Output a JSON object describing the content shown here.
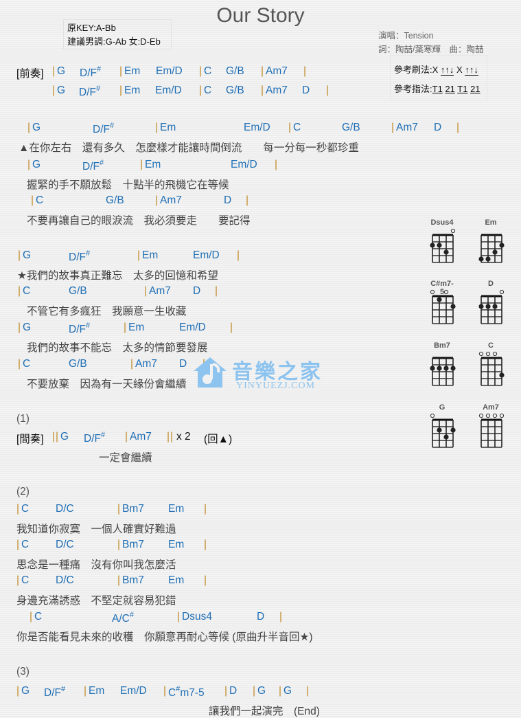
{
  "title": "Our Story",
  "key_info": {
    "original_key": "原KEY:A-Bb",
    "suggested_key": "建議男調:G-Ab 女:D-Eb"
  },
  "credits": {
    "singer": "演唱：Tension",
    "writers": "詞：陶喆/葉寒輝　曲：陶喆"
  },
  "reference": {
    "strum_label": "參考刷法:",
    "strum_pattern": [
      "X",
      "↑↑↓",
      "X",
      "↑↑↓"
    ],
    "finger_label": "參考指法:",
    "finger_pattern": [
      "T1",
      "21",
      "T1",
      "21"
    ]
  },
  "intro": {
    "label": "[前奏]",
    "lines": [
      [
        "G",
        "D/F#",
        "Em",
        "Em/D",
        "C",
        "G/B",
        "Am7"
      ],
      [
        "G",
        "D/F#",
        "Em",
        "Em/D",
        "C",
        "G/B",
        "Am7",
        "D"
      ]
    ]
  },
  "verse": [
    {
      "chords": [
        "G",
        "D/F#",
        "Em",
        "Em/D",
        "C",
        "G/B",
        "Am7",
        "D"
      ],
      "lyric": "▲在你左右　還有多久　怎麼樣才能讓時間倒流　　每一分每一秒都珍重"
    },
    {
      "chords": [
        "G",
        "D/F#",
        "Em",
        "Em/D"
      ],
      "lyric": "握緊的手不願放鬆　十點半的飛機它在等候"
    },
    {
      "chords": [
        "C",
        "G/B",
        "Am7",
        "D"
      ],
      "lyric": "不要再讓自己的眼淚流　我必須要走　　要記得"
    }
  ],
  "chorus": [
    {
      "chords": [
        "G",
        "D/F#",
        "Em",
        "Em/D"
      ],
      "lyric": "★我們的故事真正難忘　太多的回憶和希望"
    },
    {
      "chords": [
        "C",
        "G/B",
        "Am7",
        "D"
      ],
      "lyric": "不管它有多瘋狂　我願意一生收藏"
    },
    {
      "chords": [
        "G",
        "D/F#",
        "Em",
        "Em/D"
      ],
      "lyric": "我們的故事不能忘　太多的情節要發展"
    },
    {
      "chords": [
        "C",
        "G/B",
        "Am7",
        "D"
      ],
      "lyric": "不要放棄　因為有一天緣份會繼續"
    }
  ],
  "section1": {
    "marker": "(1)",
    "label": "[間奏]",
    "chords": [
      "G",
      "D/F#",
      "Am7"
    ],
    "repeat": "x 2",
    "note": "(回▲)",
    "lyric": "一定會繼續"
  },
  "section2": {
    "marker": "(2)",
    "lines": [
      {
        "chords": [
          "C",
          "D/C",
          "Bm7",
          "Em"
        ],
        "lyric": "我知道你寂寞　一個人確實好難過"
      },
      {
        "chords": [
          "C",
          "D/C",
          "Bm7",
          "Em"
        ],
        "lyric": "思念是一種痛　沒有你叫我怎麼活"
      },
      {
        "chords": [
          "C",
          "D/C",
          "Bm7",
          "Em"
        ],
        "lyric": "身邊充滿誘惑　不堅定就容易犯錯"
      },
      {
        "chords": [
          "C",
          "A/C#",
          "Dsus4",
          "D"
        ],
        "lyric": "你是否能看見未來的收穫　你願意再耐心等候 (原曲升半音回★)"
      }
    ]
  },
  "section3": {
    "marker": "(3)",
    "chords": [
      "G",
      "D/F#",
      "Em",
      "Em/D",
      "C#m7-5",
      "D",
      "G",
      "G"
    ],
    "lyric": "讓我們一起演完　(End)"
  },
  "chord_diagrams": [
    {
      "name": "Dsus4",
      "open": [
        4
      ],
      "dots": [
        [
          1,
          2
        ],
        [
          2,
          2
        ],
        [
          3,
          3
        ]
      ]
    },
    {
      "name": "Em",
      "open": [],
      "dots": [
        [
          1,
          4
        ],
        [
          2,
          4
        ],
        [
          3,
          3
        ],
        [
          4,
          2
        ]
      ]
    },
    {
      "name": "C#m7-5",
      "open": [
        1,
        3
      ],
      "dots": [
        [
          2,
          1
        ],
        [
          4,
          2
        ]
      ]
    },
    {
      "name": "D",
      "open": [
        4
      ],
      "dots": [
        [
          1,
          2
        ],
        [
          2,
          2
        ],
        [
          3,
          2
        ]
      ]
    },
    {
      "name": "Bm7",
      "open": [],
      "dots": [
        [
          1,
          2
        ],
        [
          2,
          2
        ],
        [
          3,
          2
        ],
        [
          4,
          2
        ]
      ]
    },
    {
      "name": "C",
      "open": [
        1,
        2,
        3
      ],
      "dots": [
        [
          4,
          3
        ]
      ]
    },
    {
      "name": "G",
      "open": [
        1
      ],
      "dots": [
        [
          2,
          2
        ],
        [
          3,
          3
        ],
        [
          4,
          2
        ]
      ]
    },
    {
      "name": "Am7",
      "open": [
        1,
        2,
        3,
        4
      ],
      "dots": []
    }
  ],
  "watermark": {
    "cn": "音樂之家",
    "en": "YINYUEZJ.COM"
  },
  "colors": {
    "chord": "#1f6fb5",
    "bar": "#c08b2a",
    "lyric": "#444444",
    "watermark": "#8cc3ef"
  }
}
